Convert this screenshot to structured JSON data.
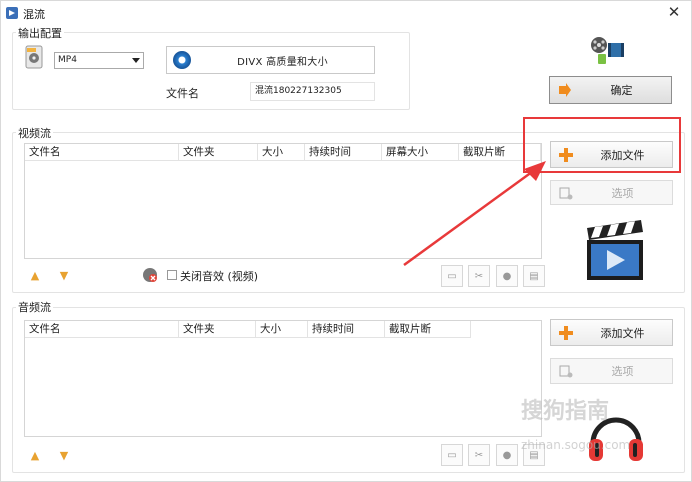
{
  "window": {
    "title": "混流",
    "close_glyph": "✕"
  },
  "output": {
    "group_label": "输出配置",
    "format": "MP4",
    "quality": "DIVX 高质量和大小",
    "filename_label": "文件名",
    "filename_value": "混流180227132305",
    "confirm_label": "确定"
  },
  "video": {
    "group_label": "视频流",
    "columns": [
      "文件名",
      "文件夹",
      "大小",
      "持续时间",
      "屏幕大小",
      "截取片断"
    ],
    "add_file_label": "添加文件",
    "options_label": "选项",
    "mute_label": "关闭音效 (视频)"
  },
  "audio": {
    "group_label": "音频流",
    "columns": [
      "文件名",
      "文件夹",
      "大小",
      "持续时间",
      "截取片断"
    ],
    "add_file_label": "添加文件",
    "options_label": "选项"
  },
  "watermark": {
    "text": "搜狗指南",
    "sub": "zhinan.sogou.com"
  },
  "colors": {
    "accent_red": "#e8393a",
    "plus_orange": "#f08c1e"
  }
}
